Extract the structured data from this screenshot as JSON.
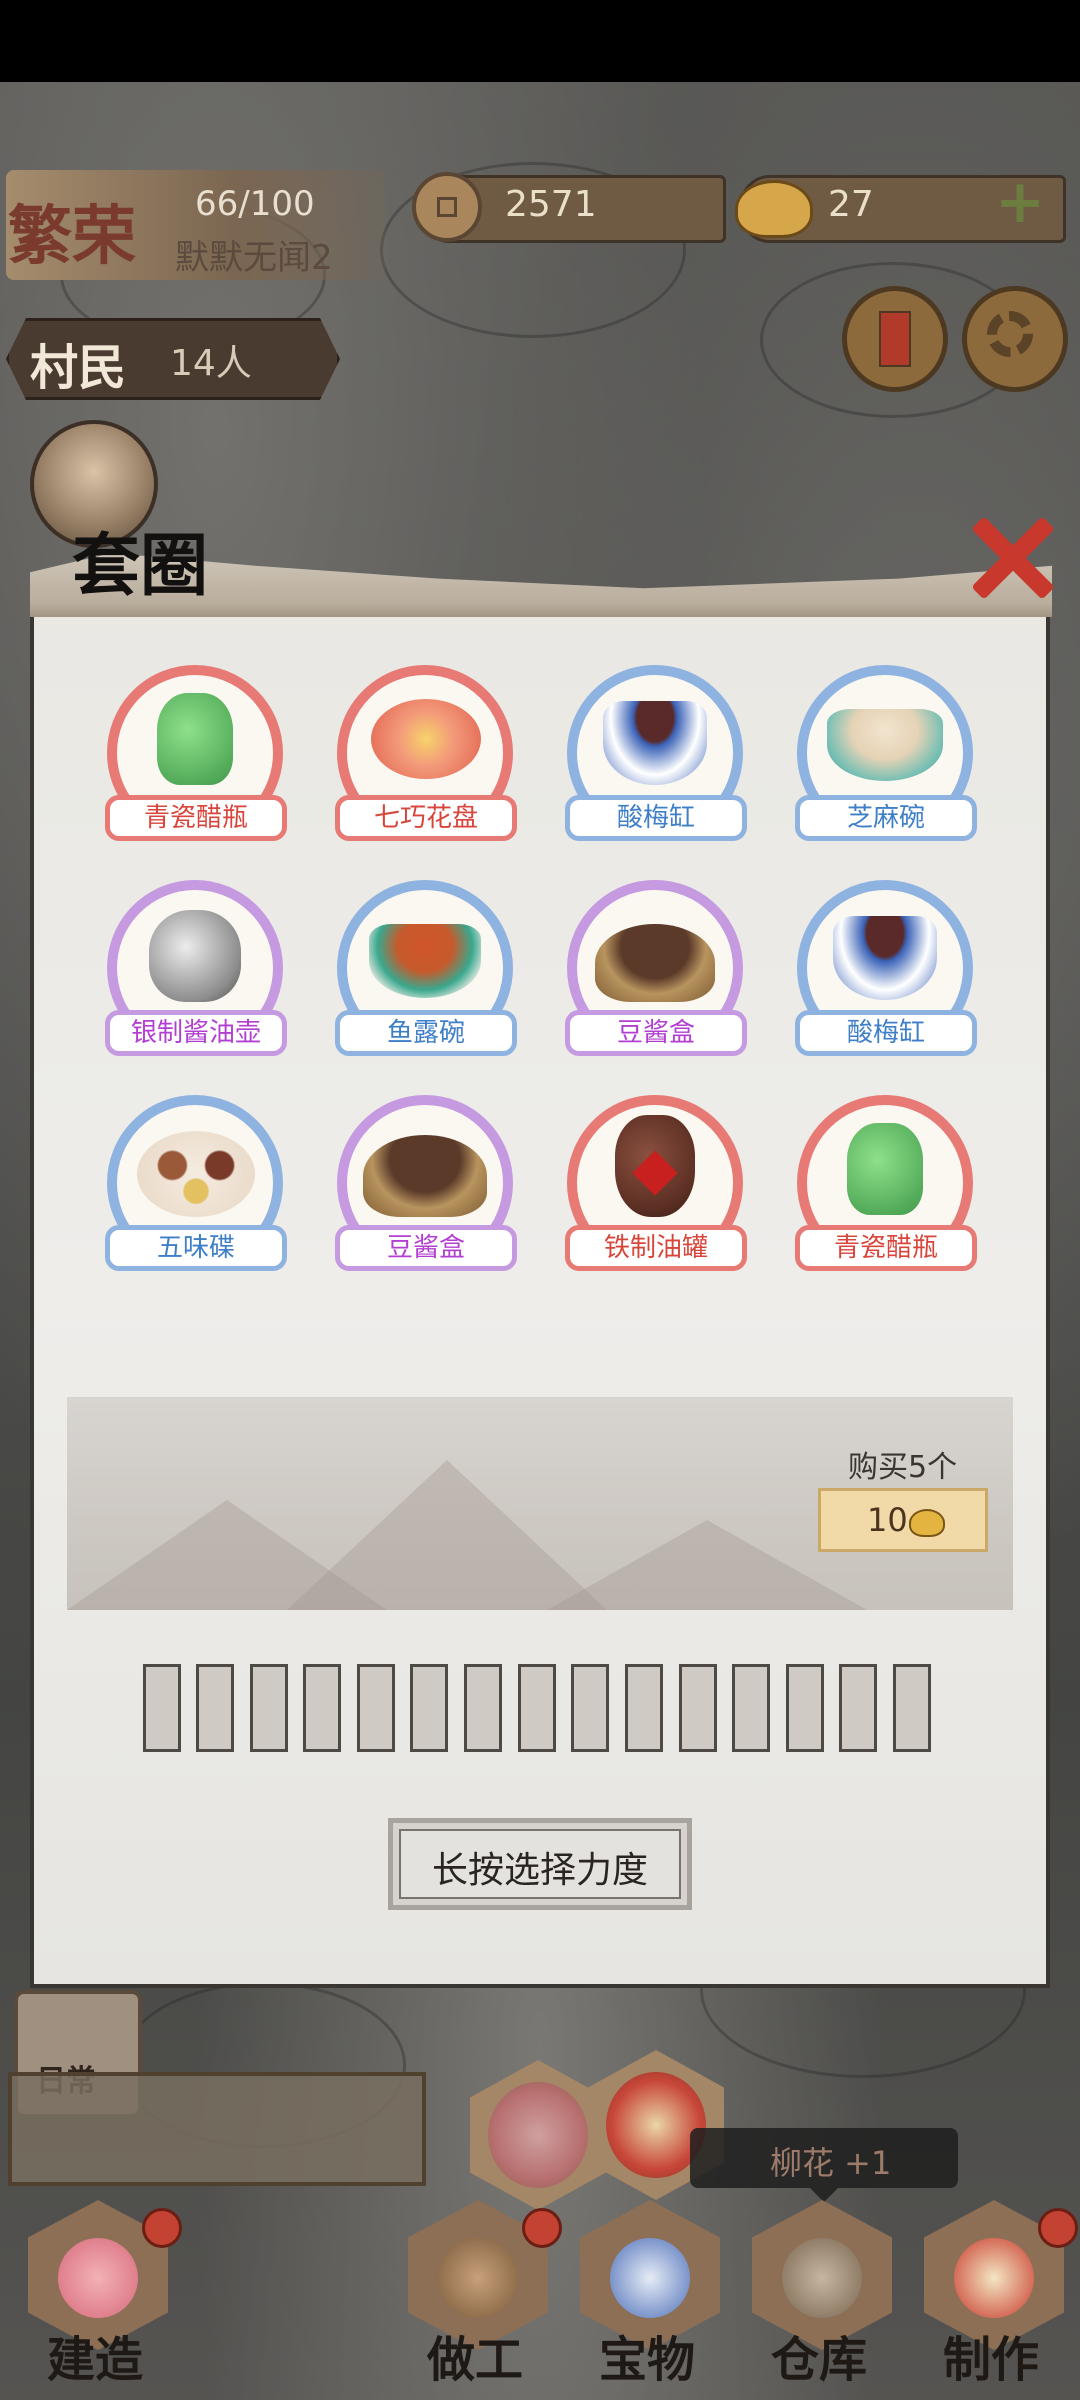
{
  "hud": {
    "settlement_name": "繁荣",
    "progress": "66/100",
    "subtitle": "默默无闻2",
    "copper_coins": "2571",
    "gold_ingots": "27",
    "villager_label": "村民",
    "villager_count": "14人",
    "scroll_button_text": "告示"
  },
  "panel": {
    "title": "套圈",
    "items": [
      {
        "label": "青瓷醋瓶",
        "color": "red",
        "icon": "green-celadon-vinegar-bottle"
      },
      {
        "label": "七巧花盘",
        "color": "red",
        "icon": "flower-plate"
      },
      {
        "label": "酸梅缸",
        "color": "blue",
        "icon": "blue-white-bowl"
      },
      {
        "label": "芝麻碗",
        "color": "blue",
        "icon": "sesame-bowl"
      },
      {
        "label": "银制酱油壶",
        "color": "purple",
        "icon": "silver-soy-sauce-pot"
      },
      {
        "label": "鱼露碗",
        "color": "blue",
        "icon": "fish-sauce-bowl"
      },
      {
        "label": "豆酱盒",
        "color": "purple",
        "icon": "bean-paste-box"
      },
      {
        "label": "酸梅缸",
        "color": "blue",
        "icon": "blue-white-bowl"
      },
      {
        "label": "五味碟",
        "color": "blue",
        "icon": "five-flavor-dish"
      },
      {
        "label": "豆酱盒",
        "color": "purple",
        "icon": "bean-paste-box"
      },
      {
        "label": "铁制油罐",
        "color": "red",
        "icon": "iron-oil-jar"
      },
      {
        "label": "青瓷醋瓶",
        "color": "red",
        "icon": "green-celadon-vinegar-bottle"
      }
    ],
    "purchase": {
      "label": "购买5个",
      "price": "10"
    },
    "ring_slots": 15,
    "action_button": "长按选择力度"
  },
  "bottom": {
    "daily_label": "日常",
    "toast_text": "柳花 +1",
    "nav": [
      {
        "label": "建造",
        "icon": "build-icon",
        "badge": true
      },
      {
        "label": "做工",
        "icon": "work-icon",
        "badge": true
      },
      {
        "label": "宝物",
        "icon": "treasure-icon",
        "badge": false
      },
      {
        "label": "仓库",
        "icon": "warehouse-icon",
        "badge": false
      },
      {
        "label": "制作",
        "icon": "craft-icon",
        "badge": true
      }
    ]
  },
  "colors": {
    "red_ring": "#e77a74",
    "blue_ring": "#8fb3e0",
    "purple_ring": "#c59ae0",
    "close_red": "#c8382c"
  }
}
